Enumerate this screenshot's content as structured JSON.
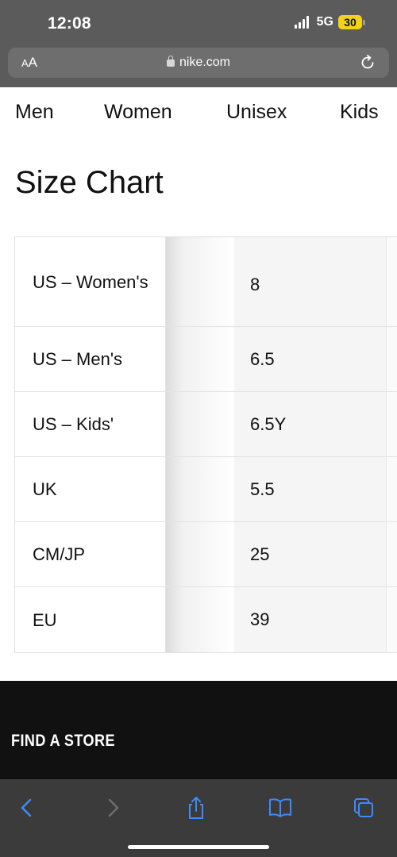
{
  "status_bar": {
    "time": "12:08",
    "network": "5G",
    "battery": "30",
    "battery_color": "#f2d21a"
  },
  "address_bar": {
    "text_size_label": "AA",
    "url": "nike.com"
  },
  "tabs": [
    "Men",
    "Women",
    "Unisex",
    "Kids"
  ],
  "page_title": "Size Chart",
  "size_chart": {
    "rows": [
      {
        "label": "US – Women's",
        "value": "8"
      },
      {
        "label": "US – Men's",
        "value": "6.5"
      },
      {
        "label": "US – Kids'",
        "value": "6.5Y"
      },
      {
        "label": "UK",
        "value": "5.5"
      },
      {
        "label": "CM/JP",
        "value": "25"
      },
      {
        "label": "EU",
        "value": "39"
      }
    ]
  },
  "footer": {
    "find_store": "FIND A STORE"
  },
  "toolbar": {
    "icons": [
      "back-icon",
      "forward-icon",
      "share-icon",
      "bookmarks-icon",
      "tabs-icon"
    ],
    "accent": "#3d8bff"
  }
}
